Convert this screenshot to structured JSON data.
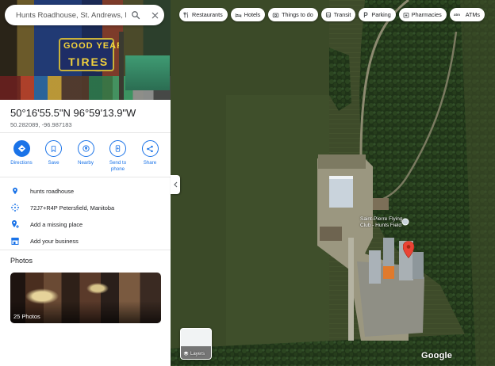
{
  "search": {
    "value": "Hunts Roadhouse, St. Andrews, MB"
  },
  "hero": {
    "sign_line1": "GOOD YEAR",
    "sign_line2": "TIRES"
  },
  "place": {
    "coordinates_dms": "50°16'55.5\"N 96°59'13.9\"W",
    "coordinates_decimal": "50.282089, -96.987183"
  },
  "actions": [
    {
      "label": "Directions",
      "icon": "directions-icon",
      "filled": true
    },
    {
      "label": "Save",
      "icon": "bookmark-icon",
      "filled": false
    },
    {
      "label": "Nearby",
      "icon": "nearby-icon",
      "filled": false
    },
    {
      "label": "Send to phone",
      "icon": "phone-icon",
      "filled": false
    },
    {
      "label": "Share",
      "icon": "share-icon",
      "filled": false
    }
  ],
  "info_rows": [
    {
      "text": "hunts roadhouse",
      "icon": "location-pin-icon"
    },
    {
      "text": "72J7+R4P Petersfield, Manitoba",
      "icon": "plus-code-icon"
    },
    {
      "text": "Add a missing place",
      "icon": "add-place-icon"
    },
    {
      "text": "Add your business",
      "icon": "business-icon"
    }
  ],
  "photos": {
    "title": "Photos",
    "count_label": "25 Photos"
  },
  "chips": [
    {
      "label": "Restaurants",
      "icon": "fork-knife-icon"
    },
    {
      "label": "Hotels",
      "icon": "bed-icon"
    },
    {
      "label": "Things to do",
      "icon": "camera-icon"
    },
    {
      "label": "Transit",
      "icon": "bus-icon"
    },
    {
      "label": "Parking",
      "icon": "parking-icon"
    },
    {
      "label": "Pharmacies",
      "icon": "pharmacy-icon"
    },
    {
      "label": "ATMs",
      "icon": "atm-icon"
    }
  ],
  "map": {
    "place_label": "Saint-Pierre Flying Club - Hunts Field",
    "layers_label": "Layers",
    "brand": "Google"
  },
  "colors": {
    "accent": "#1a73e8",
    "marker": "#ea4335"
  }
}
